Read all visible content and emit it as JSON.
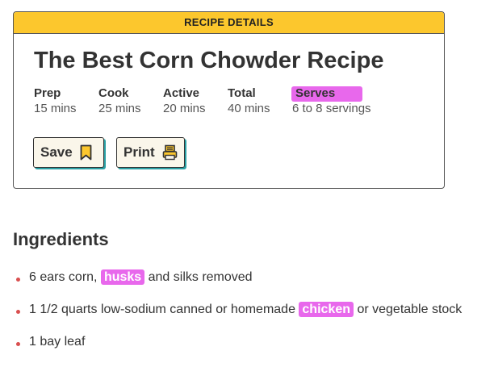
{
  "card": {
    "header": "RECIPE DETAILS",
    "title": "The Best Corn Chowder Recipe",
    "meta": [
      {
        "label": "Prep",
        "value": "15 mins"
      },
      {
        "label": "Cook",
        "value": "25 mins"
      },
      {
        "label": "Active",
        "value": "20 mins"
      },
      {
        "label": "Total",
        "value": "40 mins"
      },
      {
        "label": "Serves",
        "value": "6 to 8 servings"
      }
    ],
    "buttons": {
      "save": "Save",
      "print": "Print"
    }
  },
  "ingredients": {
    "title": "Ingredients",
    "items": [
      {
        "before": "6 ears corn, ",
        "highlight": "husks",
        "after": " and silks removed"
      },
      {
        "before": "1 1/2 quarts low-sodium canned or homemade ",
        "highlight": "chicken",
        "after": " or vegetable stock"
      },
      {
        "before": "1 bay leaf",
        "highlight": "",
        "after": ""
      }
    ]
  },
  "colors": {
    "header": "#fcc72d",
    "highlight": "#e868ec",
    "button_shadow": "#2aa0a4",
    "bullet": "#d94f4f"
  },
  "icons": {
    "save": "bookmark-icon",
    "print": "printer-icon"
  }
}
